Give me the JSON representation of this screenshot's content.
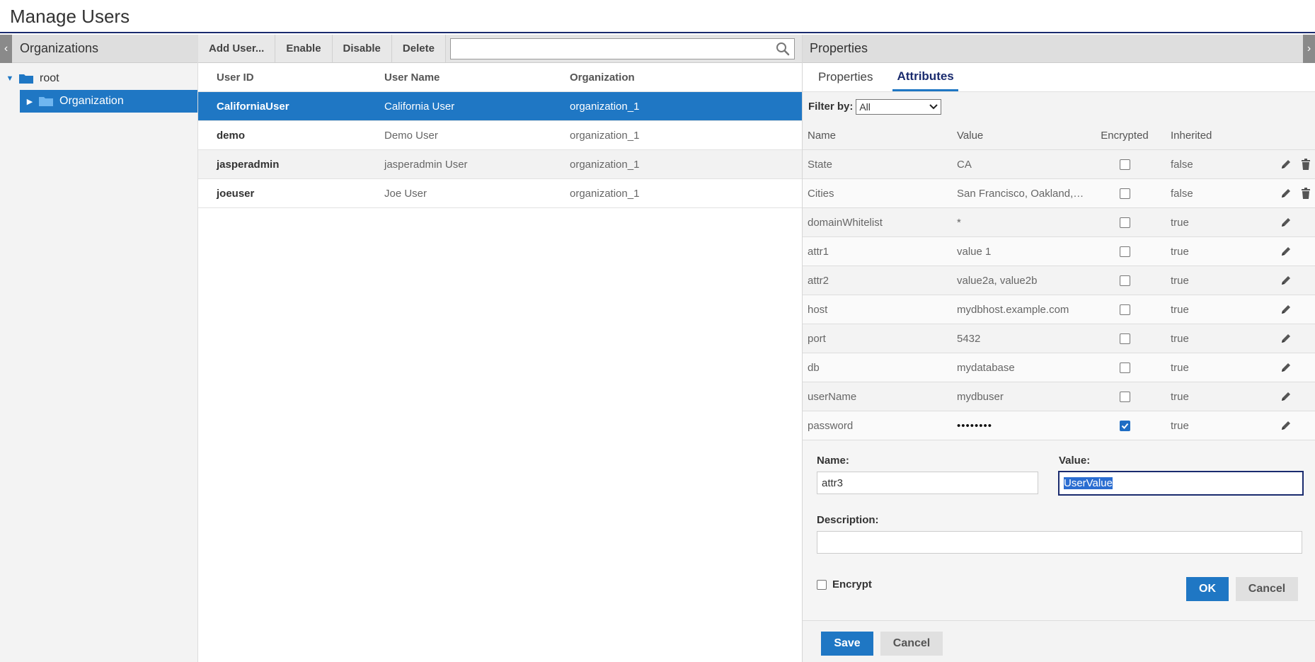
{
  "header": {
    "title": "Manage Users"
  },
  "organizations": {
    "title": "Organizations",
    "collapse_glyph": "‹",
    "tree": [
      {
        "label": "root",
        "expanded": true,
        "level": 0
      },
      {
        "label": "Organization",
        "expanded": false,
        "level": 1,
        "selected": true
      }
    ]
  },
  "toolbar": {
    "add_user": "Add User...",
    "enable": "Enable",
    "disable": "Disable",
    "delete": "Delete",
    "search_value": ""
  },
  "users": {
    "columns": [
      "User ID",
      "User Name",
      "Organization"
    ],
    "rows": [
      {
        "id": "CaliforniaUser",
        "name": "California User",
        "org": "organization_1",
        "selected": true
      },
      {
        "id": "demo",
        "name": "Demo User",
        "org": "organization_1"
      },
      {
        "id": "jasperadmin",
        "name": "jasperadmin User",
        "org": "organization_1"
      },
      {
        "id": "joeuser",
        "name": "Joe User",
        "org": "organization_1"
      }
    ]
  },
  "properties": {
    "title": "Properties",
    "expand_glyph": "›",
    "tabs": [
      {
        "label": "Properties",
        "active": false
      },
      {
        "label": "Attributes",
        "active": true
      }
    ],
    "filter_label": "Filter by:",
    "filter_value": "All",
    "attr_columns": [
      "Name",
      "Value",
      "Encrypted",
      "Inherited"
    ],
    "attributes": [
      {
        "name": "State",
        "value": "CA",
        "encrypted": false,
        "inherited": "false",
        "deletable": true
      },
      {
        "name": "Cities",
        "value": "San Francisco, Oakland, San Jose",
        "encrypted": false,
        "inherited": "false",
        "deletable": true
      },
      {
        "name": "domainWhitelist",
        "value": "*",
        "encrypted": false,
        "inherited": "true",
        "deletable": false
      },
      {
        "name": "attr1",
        "value": "value 1",
        "encrypted": false,
        "inherited": "true",
        "deletable": false
      },
      {
        "name": "attr2",
        "value": "value2a, value2b",
        "encrypted": false,
        "inherited": "true",
        "deletable": false
      },
      {
        "name": "host",
        "value": "mydbhost.example.com",
        "encrypted": false,
        "inherited": "true",
        "deletable": false
      },
      {
        "name": "port",
        "value": "5432",
        "encrypted": false,
        "inherited": "true",
        "deletable": false
      },
      {
        "name": "db",
        "value": "mydatabase",
        "encrypted": false,
        "inherited": "true",
        "deletable": false
      },
      {
        "name": "userName",
        "value": "mydbuser",
        "encrypted": false,
        "inherited": "true",
        "deletable": false
      },
      {
        "name": "password",
        "value": "••••••••",
        "encrypted": true,
        "inherited": "true",
        "deletable": false
      }
    ],
    "form": {
      "name_label": "Name:",
      "name_value": "attr3",
      "value_label": "Value:",
      "value_value": "UserValue",
      "description_label": "Description:",
      "description_value": "",
      "encrypt_label": "Encrypt",
      "ok_label": "OK",
      "cancel_label": "Cancel"
    },
    "save_label": "Save",
    "cancel_label": "Cancel"
  },
  "colors": {
    "accent": "#1f77c4",
    "navy": "#1a2b6e",
    "panel": "#f3f3f3"
  }
}
